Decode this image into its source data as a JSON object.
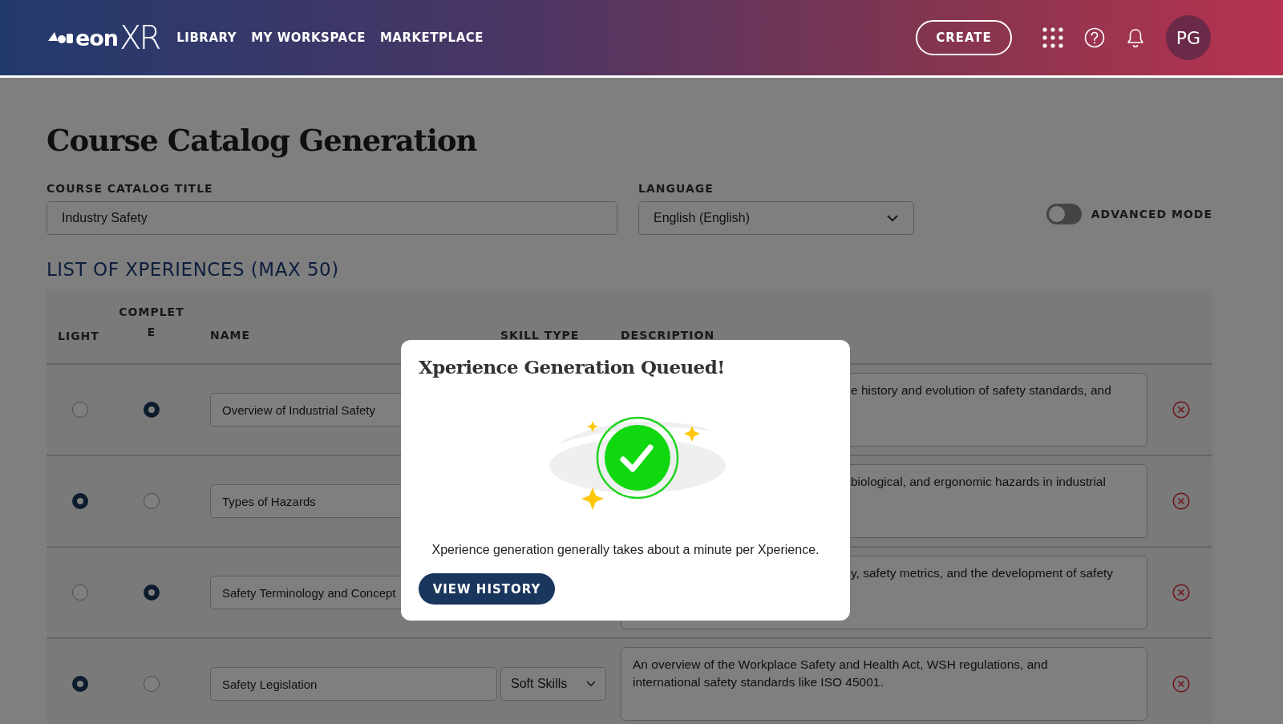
{
  "header": {
    "logo": {
      "word": "eon",
      "mark": "XR"
    },
    "nav": [
      {
        "label": "LIBRARY"
      },
      {
        "label": "MY WORKSPACE"
      },
      {
        "label": "MARKETPLACE"
      }
    ],
    "create_button": "CREATE",
    "avatar": "PG"
  },
  "page": {
    "title": "Course Catalog Generation",
    "catalog_title": {
      "label": "COURSE CATALOG TITLE",
      "value": "Industry Safety"
    },
    "language": {
      "label": "LANGUAGE",
      "value": "English (English)"
    },
    "advanced_mode": {
      "label": "ADVANCED MODE",
      "on": false
    },
    "list_title": "LIST OF XPERIENCES (MAX 50)",
    "table": {
      "columns": [
        "LIGHT",
        "COMPLETE",
        "NAME",
        "SKILL TYPE",
        "DESCRIPTION"
      ],
      "rows": [
        {
          "light_selected": false,
          "complete_selected": true,
          "name": "Overview of Industrial Safety",
          "description": "e history and evolution of safety standards, and",
          "description_cut": true
        },
        {
          "light_selected": true,
          "complete_selected": false,
          "name": "Types of Hazards",
          "description": "biological, and ergonomic hazards in industrial",
          "description_cut": true
        },
        {
          "light_selected": false,
          "complete_selected": true,
          "name": "Safety Terminology and Concept",
          "description": "y, safety metrics, and the development of safety",
          "description_cut": true
        },
        {
          "light_selected": true,
          "complete_selected": false,
          "name": "Safety Legislation",
          "skill_type": "Soft Skills",
          "description": "An overview of the Workplace Safety and Health Act, WSH regulations, and international safety standards like ISO 45001.",
          "description_cut": false
        }
      ]
    }
  },
  "dialog": {
    "title": "Xperience Generation Queued!",
    "message": "Xperience generation generally takes about a minute per Xperience.",
    "button": "VIEW HISTORY"
  }
}
